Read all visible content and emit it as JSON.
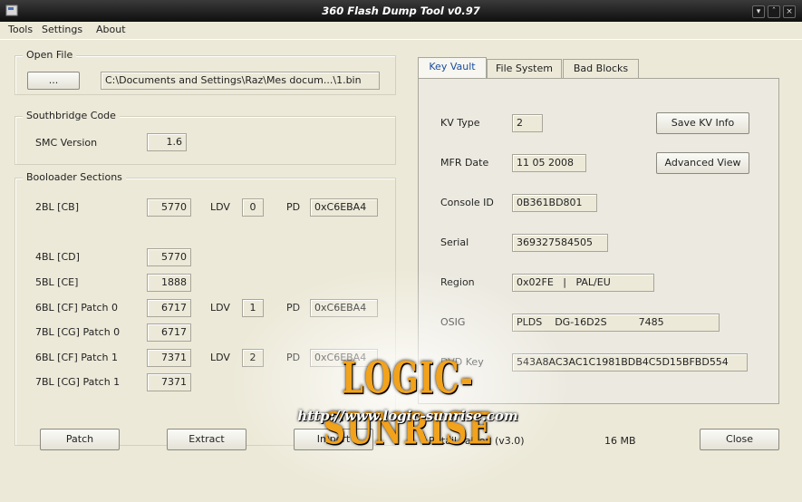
{
  "window": {
    "title": "360 Flash Dump Tool  v0.97"
  },
  "menu": [
    "Tools",
    "Settings",
    "About"
  ],
  "open_file": {
    "title": "Open File",
    "browse_label": "...",
    "path": "C:\\Documents and Settings\\Raz\\Mes docum...\\1.bin"
  },
  "southbridge": {
    "title": "Southbridge Code",
    "smc_label": "SMC Version",
    "smc_value": "1.6"
  },
  "bootloader": {
    "title": "Booloader Sections",
    "ldv_label": "LDV",
    "pd_label": "PD",
    "rows": [
      {
        "label": "2BL [CB]",
        "value": "5770",
        "ldv": "0",
        "pd": "0xC6EBA4"
      },
      {
        "label": "4BL [CD]",
        "value": "5770"
      },
      {
        "label": "5BL [CE]",
        "value": "1888"
      },
      {
        "label": "6BL [CF] Patch 0",
        "value": "6717",
        "ldv": "1",
        "pd": "0xC6EBA4"
      },
      {
        "label": "7BL [CG] Patch 0",
        "value": "6717"
      },
      {
        "label": "6BL [CF] Patch 1",
        "value": "7371",
        "ldv": "2",
        "pd": "0xC6EBA4"
      },
      {
        "label": "7BL [CG] Patch 1",
        "value": "7371"
      }
    ]
  },
  "tabs": [
    "Key Vault",
    "File System",
    "Bad Blocks"
  ],
  "keyvault": {
    "kv_type_label": "KV Type",
    "kv_type": "2",
    "mfr_label": "MFR Date",
    "mfr": "11 05 2008",
    "console_label": "Console ID",
    "console": "0B361BD801",
    "serial_label": "Serial",
    "serial": "369327584505",
    "region_label": "Region",
    "region": "0x02FE   |   PAL/EU",
    "osig_label": "OSIG",
    "osig": "PLDS    DG-16D2S          7485",
    "dvd_label": "DVD Key",
    "dvd": "543A8AC3AC1C1981BDB4C5D15BFBD554",
    "save_kv": "Save KV Info",
    "advanced": "Advanced View"
  },
  "bottom": {
    "patch": "Patch",
    "extract": "Extract",
    "import": "Import",
    "status": "Retail Falcon (v3.0)",
    "size": "16 MB",
    "close": "Close"
  },
  "watermark": {
    "name": "LOGIC-SUNRISE",
    "url": "http://www.logic-sunrise.com"
  },
  "colors": {
    "titlebar": "#0f0f0f",
    "background": "#ece9d8",
    "active_tab_text": "#1a4ea0",
    "watermark": "#f2a21b"
  }
}
